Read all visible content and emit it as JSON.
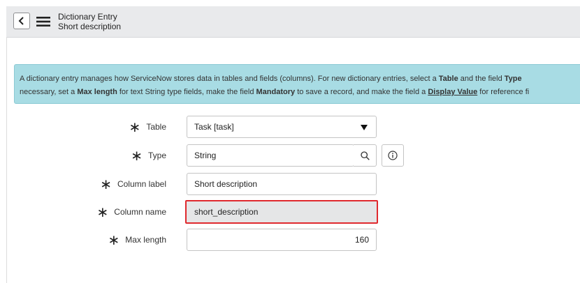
{
  "header": {
    "title": "Dictionary Entry",
    "subtitle": "Short description"
  },
  "info": {
    "line1_a": "A dictionary entry manages how ServiceNow stores data in tables and fields (columns). For new dictionary entries, select a ",
    "line1_b": "Table",
    "line1_c": " and the field ",
    "line1_d": "Type",
    "line2_a": "necessary, set a ",
    "line2_b": "Max length",
    "line2_c": " for text String type fields, make the field ",
    "line2_d": "Mandatory",
    "line2_e": " to save a record, and make the field a ",
    "line2_f": "Display Value",
    "line2_g": " for reference fi"
  },
  "form": {
    "table": {
      "label": "Table",
      "value": "Task [task]"
    },
    "type": {
      "label": "Type",
      "value": "String"
    },
    "column_label": {
      "label": "Column label",
      "value": "Short description"
    },
    "column_name": {
      "label": "Column name",
      "value": "short_description"
    },
    "max_length": {
      "label": "Max length",
      "value": "160"
    },
    "required_mark": "∗"
  },
  "icons": {
    "back": "chevron-left-icon",
    "menu": "hamburger-menu-icon",
    "caret": "caret-down-icon",
    "search": "search-icon",
    "info": "info-icon"
  },
  "colors": {
    "info_bg": "#a8dce4",
    "highlight": "#e0292e",
    "header_bg": "#e9eaec"
  }
}
